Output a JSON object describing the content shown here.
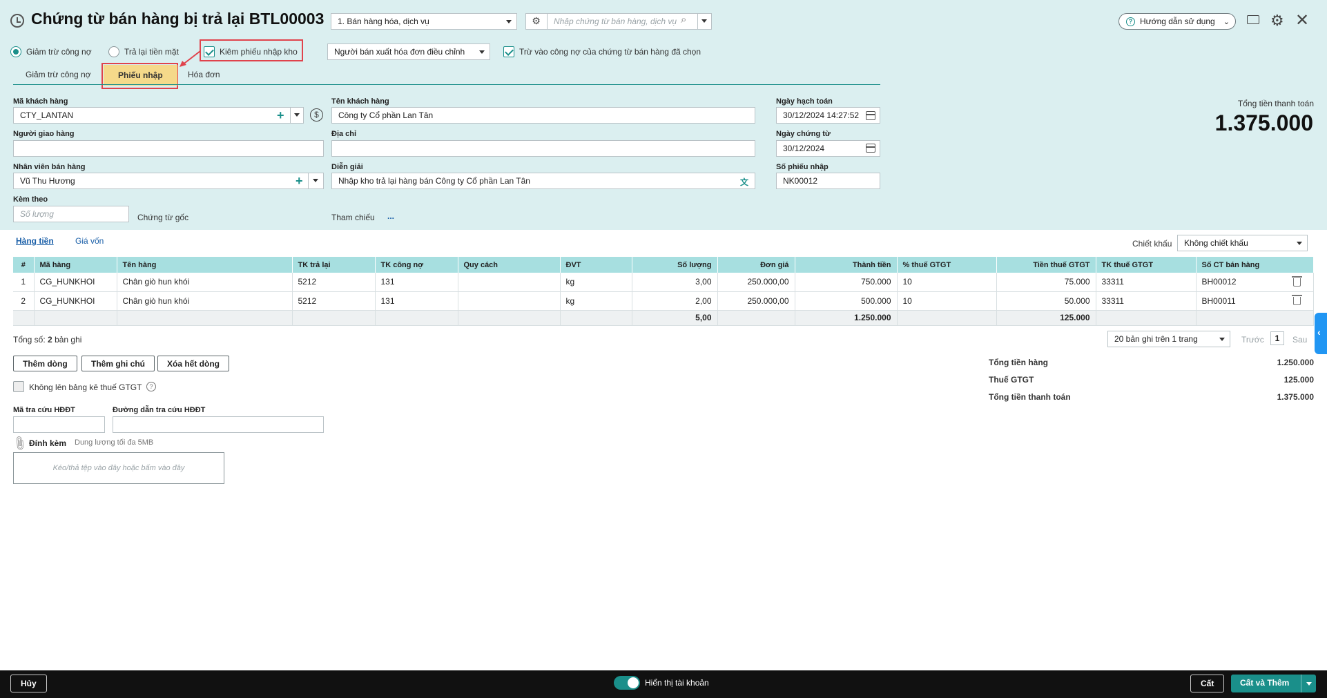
{
  "header": {
    "title": "Chứng từ bán hàng bị trả lại BTL00003",
    "type_select": "1. Bán hàng hóa, dịch vụ",
    "search_placeholder": "Nhập chứng từ bán hàng, dịch vụ",
    "help_label": "Hướng dẫn sử dụng"
  },
  "options": {
    "radio_debt": "Giảm trừ công nợ",
    "radio_cash": "Trả lại tiền mặt",
    "check_warehouse": "Kiêm phiếu nhập kho",
    "seller_select": "Người bán xuất hóa đơn điều chỉnh",
    "check_debt": "Trừ vào công nợ của chứng từ bán hàng đã chọn"
  },
  "tabs": [
    "Giảm trừ công nợ",
    "Phiếu nhập",
    "Hóa đơn"
  ],
  "form": {
    "customer_code_label": "Mã khách hàng",
    "customer_code": "CTY_LANTAN",
    "customer_name_label": "Tên khách hàng",
    "customer_name": "Công ty Cổ phần Lan Tân",
    "deliverer_label": "Người giao hàng",
    "deliverer": "",
    "address_label": "Địa chỉ",
    "address": "",
    "salesperson_label": "Nhân viên bán hàng",
    "salesperson": "Vũ Thu Hương",
    "description_label": "Diễn giải",
    "description": "Nhập kho trả lại hàng bán Công ty Cổ phần Lan Tân",
    "attach_label": "Kèm theo",
    "attach_placeholder": "Số lượng",
    "original_doc": "Chứng từ gốc",
    "reference_label": "Tham chiếu",
    "reference_value": "...",
    "posting_date_label": "Ngày hạch toán",
    "posting_date": "30/12/2024 14:27:52",
    "doc_date_label": "Ngày chứng từ",
    "doc_date": "30/12/2024",
    "receipt_no_label": "Số phiếu nhập",
    "receipt_no": "NK00012"
  },
  "total_box": {
    "label": "Tổng tiền thanh toán",
    "value": "1.375.000"
  },
  "detail_tabs": [
    "Hàng tiền",
    "Giá vốn"
  ],
  "discount": {
    "label": "Chiết khấu",
    "value": "Không chiết khấu"
  },
  "table": {
    "headers": [
      "#",
      "Mã hàng",
      "Tên hàng",
      "TK trả lại",
      "TK công nợ",
      "Quy cách",
      "ĐVT",
      "Số lượng",
      "Đơn giá",
      "Thành tiền",
      "% thuế GTGT",
      "Tiền thuế GTGT",
      "TK thuế GTGT",
      "Số CT bán hàng"
    ],
    "rows": [
      [
        "1",
        "CG_HUNKHOI",
        "Chân giò hun khói",
        "5212",
        "131",
        "",
        "kg",
        "3,00",
        "250.000,00",
        "750.000",
        "10",
        "75.000",
        "33311",
        "BH00012"
      ],
      [
        "2",
        "CG_HUNKHOI",
        "Chân giò hun khói",
        "5212",
        "131",
        "",
        "kg",
        "2,00",
        "250.000,00",
        "500.000",
        "10",
        "50.000",
        "33311",
        "BH00011"
      ]
    ],
    "sum_quantity": "5,00",
    "sum_amount": "1.250.000",
    "sum_tax": "125.000"
  },
  "records": {
    "prefix": "Tổng số:",
    "count": "2",
    "suffix": "bản ghi",
    "page_size": "20 bản ghi trên 1 trang",
    "prev": "Trước",
    "page": "1",
    "next": "Sau"
  },
  "buttons": {
    "add_row": "Thêm dòng",
    "add_note": "Thêm ghi chú",
    "delete_all": "Xóa hết dòng"
  },
  "no_vat_list": "Không lên bảng kê thuế GTGT",
  "einvoice": {
    "lookup_code_label": "Mã tra cứu HĐĐT",
    "lookup_url_label": "Đường dẫn tra cứu HĐĐT"
  },
  "attachment": {
    "label": "Đính kèm",
    "limit": "Dung lượng tối đa 5MB",
    "drop_text": "Kéo/thả tệp vào đây hoặc bấm vào đây"
  },
  "summary": {
    "goods_label": "Tổng tiền hàng",
    "goods": "1.250.000",
    "vat_label": "Thuế GTGT",
    "vat": "125.000",
    "total_label": "Tổng tiền thanh toán",
    "total": "1.375.000"
  },
  "footer": {
    "cancel": "Hủy",
    "show_account": "Hiển thị tài khoản",
    "save": "Cất",
    "save_add": "Cất và Thêm"
  }
}
